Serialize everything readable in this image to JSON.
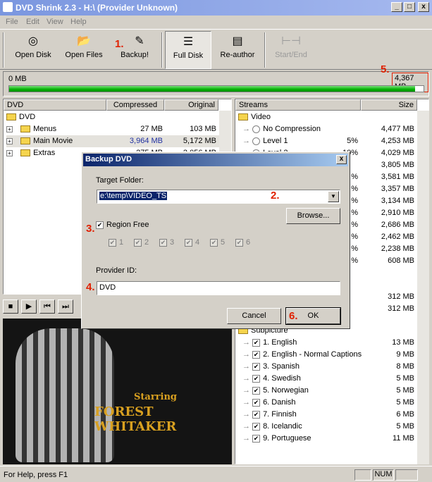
{
  "window": {
    "title": "DVD Shrink 2.3 - H:\\ (Provider Unknown)",
    "min": "_",
    "max": "□",
    "close": "x"
  },
  "menu": [
    "File",
    "Edit",
    "View",
    "Help"
  ],
  "toolbar": {
    "open_disk": "Open Disk",
    "open_files": "Open Files",
    "backup": "Backup!",
    "full_disk": "Full Disk",
    "reauthor": "Re-author",
    "start_end": "Start/End"
  },
  "annotations": {
    "a1": "1.",
    "a2": "2.",
    "a3": "3.",
    "a4": "4.",
    "a5": "5.",
    "a6": "6."
  },
  "size_bar": {
    "min_label": "0 MB",
    "max_label": "4,367 MB",
    "fill_fraction": 0.98
  },
  "dvd_tree": {
    "headers": {
      "name": "DVD",
      "compressed": "Compressed",
      "original": "Original"
    },
    "root": "DVD",
    "rows": [
      {
        "name": "Menus",
        "compressed": "27 MB",
        "original": "103 MB"
      },
      {
        "name": "Main Movie",
        "compressed": "3,964 MB",
        "original": "5,172 MB"
      },
      {
        "name": "Extras",
        "compressed": "275 MB",
        "original": "2,056 MB"
      }
    ]
  },
  "streams": {
    "headers": {
      "name": "Streams",
      "size": "Size"
    },
    "video_label": "Video",
    "video_rows": [
      {
        "name": "No Compression",
        "pct": "",
        "size": "4,477 MB"
      },
      {
        "name": "Level 1",
        "pct": "5%",
        "size": "4,253 MB"
      },
      {
        "name": "Level 2",
        "pct": "10%",
        "size": "4,029 MB"
      },
      {
        "name": "",
        "pct": "",
        "size": "3,805 MB"
      },
      {
        "name": "",
        "pct": "%",
        "size": "3,581 MB"
      },
      {
        "name": "",
        "pct": "%",
        "size": "3,357 MB"
      },
      {
        "name": "",
        "pct": "%",
        "size": "3,134 MB"
      },
      {
        "name": "",
        "pct": "%",
        "size": "2,910 MB"
      },
      {
        "name": "",
        "pct": "%",
        "size": "2,686 MB"
      },
      {
        "name": "",
        "pct": "%",
        "size": "2,462 MB"
      },
      {
        "name": "",
        "pct": "%",
        "size": "2,238 MB"
      },
      {
        "name": "",
        "pct": "%",
        "size": "608 MB"
      }
    ],
    "audio_sizes": [
      "312 MB",
      "312 MB"
    ],
    "subpicture_label": "Subpicture",
    "sub_rows": [
      {
        "name": "1. English",
        "size": "13 MB"
      },
      {
        "name": "2. English - Normal Captions",
        "size": "9 MB"
      },
      {
        "name": "3. Spanish",
        "size": "8 MB"
      },
      {
        "name": "4. Swedish",
        "size": "5 MB"
      },
      {
        "name": "5. Norwegian",
        "size": "5 MB"
      },
      {
        "name": "6. Danish",
        "size": "5 MB"
      },
      {
        "name": "7. Finnish",
        "size": "6 MB"
      },
      {
        "name": "8. Icelandic",
        "size": "5 MB"
      },
      {
        "name": "9. Portuguese",
        "size": "11 MB"
      }
    ]
  },
  "player": {
    "starring": "Starring",
    "actor": "FOREST WHITAKER"
  },
  "dialog": {
    "title": "Backup DVD",
    "close": "x",
    "target_label": "Target Folder:",
    "target_value": "e:\\temp\\VIDEO_TS",
    "browse": "Browse...",
    "region_free": "Region Free",
    "regions": [
      "1",
      "2",
      "3",
      "4",
      "5",
      "6"
    ],
    "provider_label": "Provider ID:",
    "provider_value": "DVD",
    "cancel": "Cancel",
    "ok": "OK"
  },
  "status": {
    "help": "For Help, press F1",
    "num": "NUM"
  }
}
